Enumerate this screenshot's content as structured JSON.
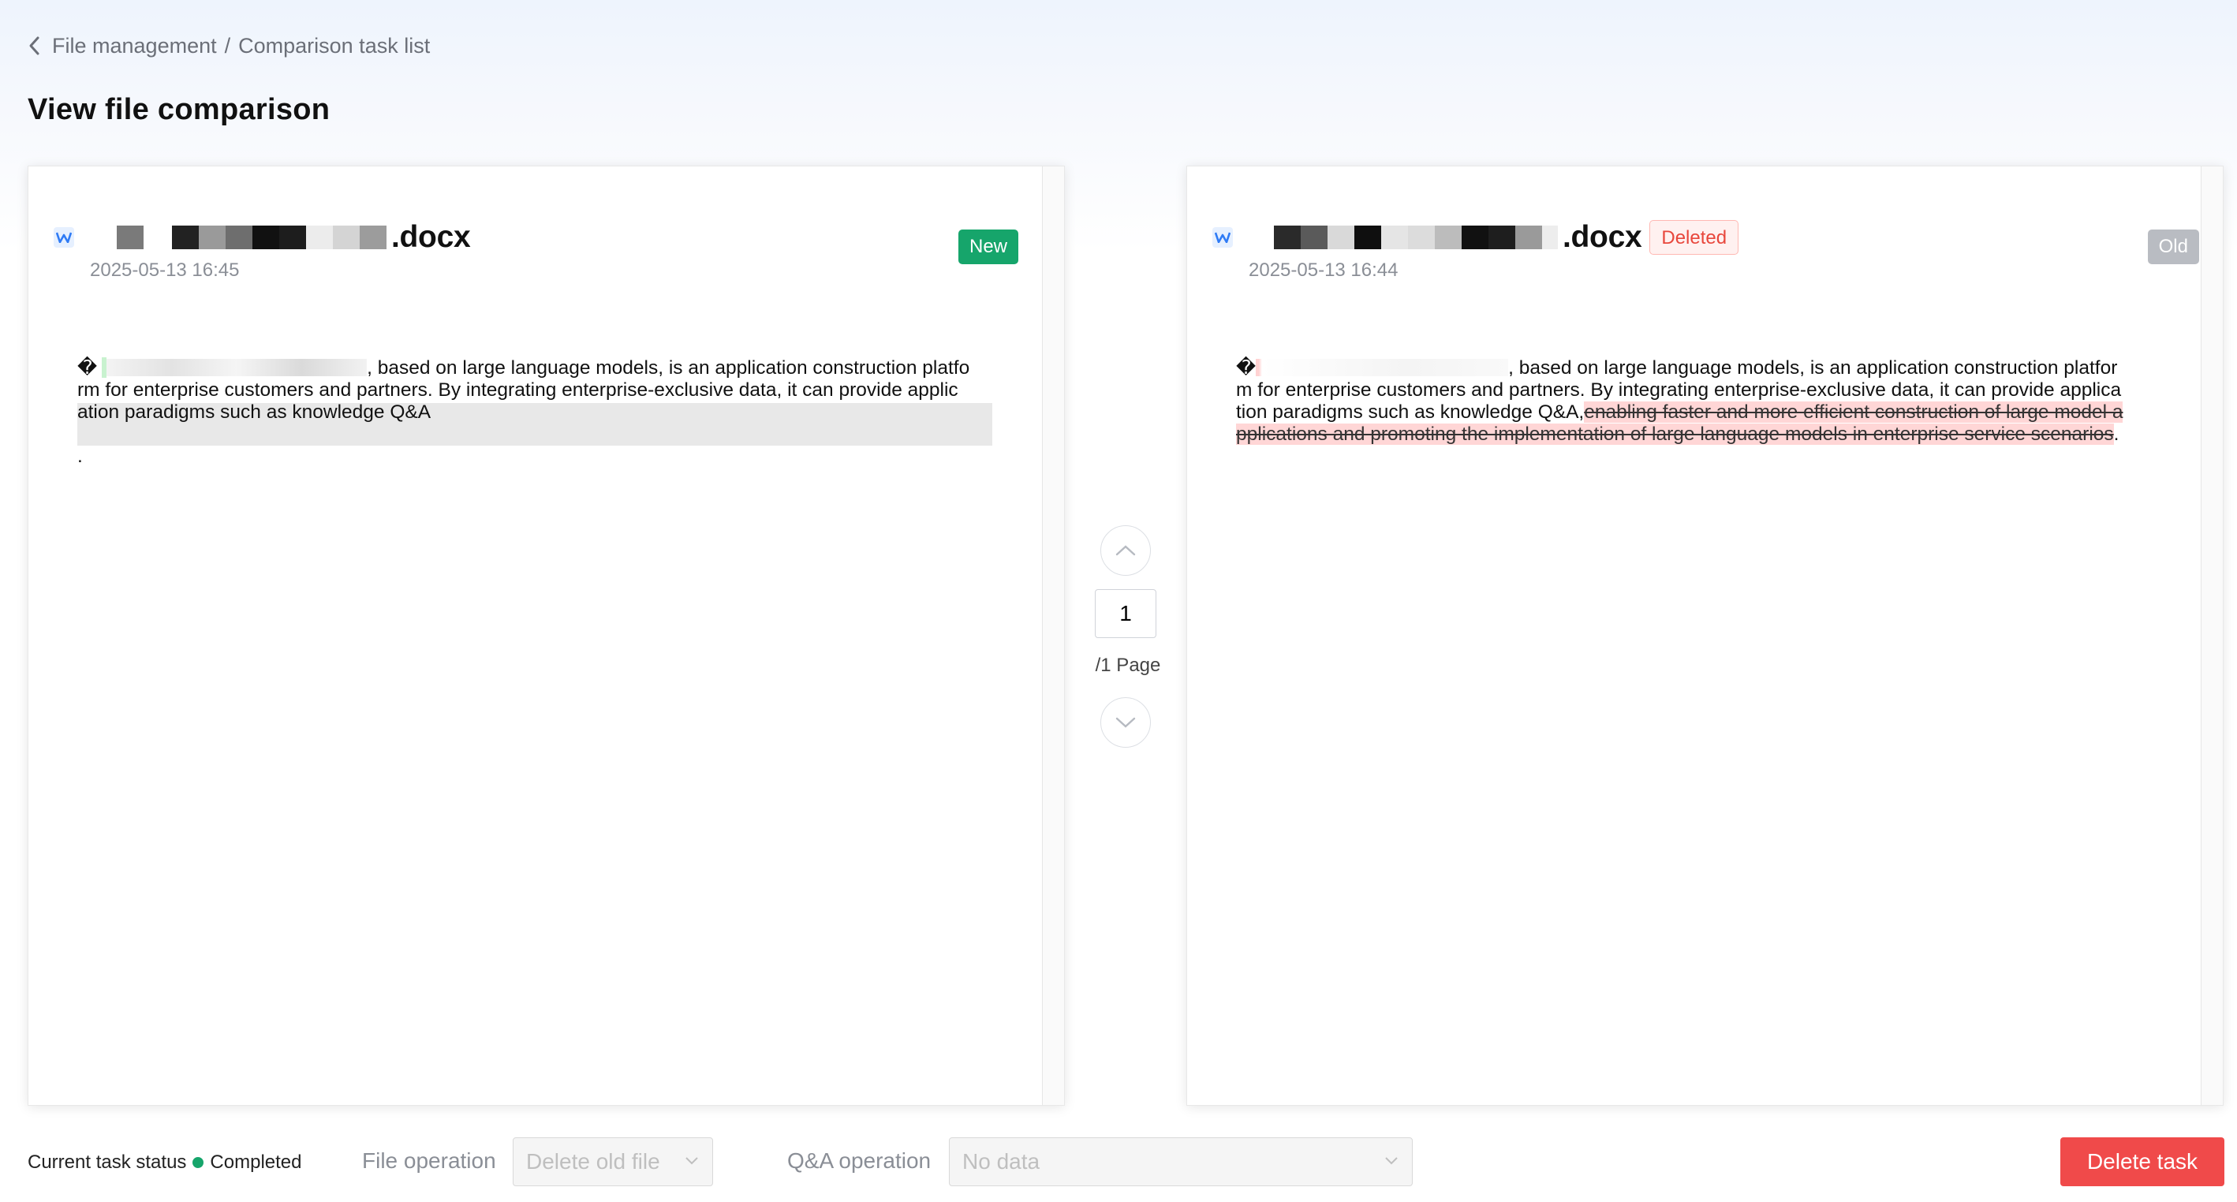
{
  "breadcrumb": {
    "back_icon": "chevron-left-icon",
    "items": [
      "File management",
      "Comparison task list"
    ],
    "separator": "/"
  },
  "page_title": "View file comparison",
  "left_panel": {
    "file_name_suffix": ".docx",
    "file_icon": "word-icon",
    "date": "2025-05-13 16:45",
    "tag": "New",
    "tag_color": "#16a56b",
    "content": {
      "glyph": "�",
      "line1": ", based on large language models, is an application construction platfo",
      "line2": "rm for enterprise customers and partners. By integrating enterprise-exclusive data, it can provide applic",
      "line3": "ation paradigms such as knowledge Q&A",
      "line4": "."
    }
  },
  "right_panel": {
    "file_name_suffix": ".docx",
    "file_icon": "word-icon",
    "date": "2025-05-13 16:44",
    "status_tag": "Deleted",
    "tag": "Old",
    "content": {
      "glyph": "�",
      "line1": ", based on large language models, is an application construction platfor",
      "line2": "m for enterprise customers and partners. By integrating enterprise-exclusive data, it can provide applica",
      "line3": "tion paradigms such as knowledge Q&A,",
      "deleted_part1": "enabling faster and more efficient construction of large model a",
      "deleted_part2": "pplications and promoting the implementation of large language models in enterprise service scenarios",
      "line4_end": "."
    }
  },
  "pager": {
    "current_page": "1",
    "total_label": "/1 Page"
  },
  "bottom_bar": {
    "status_label": "Current task status",
    "status_value": "Completed",
    "status_color": "#16a56b",
    "file_operation_label": "File operation",
    "file_operation_value": "Delete old file",
    "qa_operation_label": "Q&A operation",
    "qa_operation_value": "No data",
    "delete_button": "Delete task",
    "delete_color": "#f04a4a"
  }
}
